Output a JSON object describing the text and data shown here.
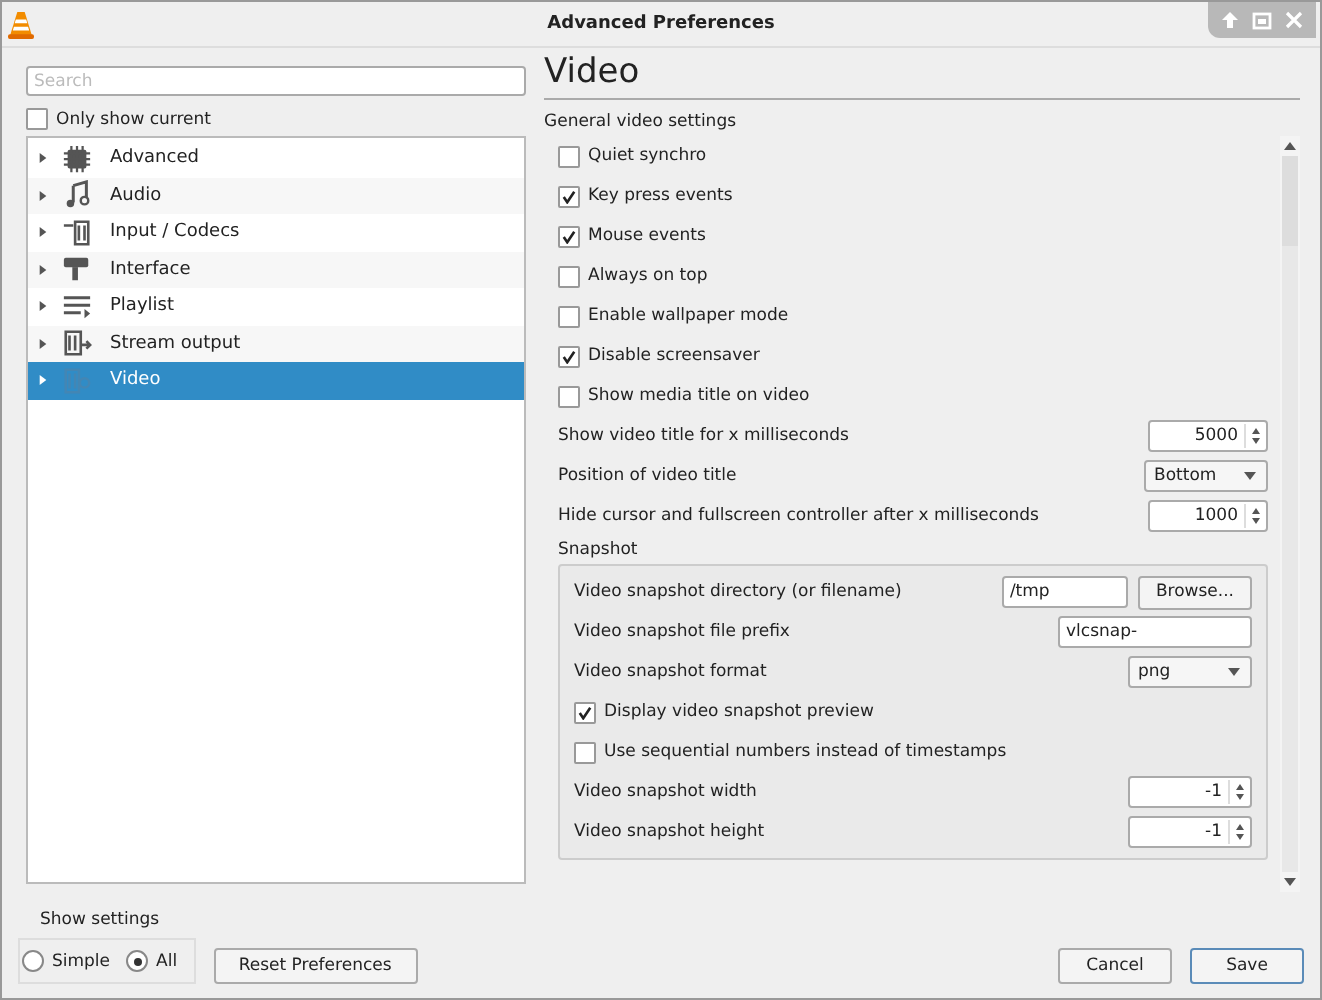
{
  "window": {
    "title": "Advanced Preferences"
  },
  "sidebar": {
    "search": {
      "placeholder": "Search"
    },
    "only_show_current": {
      "label": "Only show current",
      "checked": false
    },
    "tree": [
      {
        "label": "Advanced",
        "selected": false,
        "expanded": false
      },
      {
        "label": "Audio",
        "selected": false,
        "expanded": false
      },
      {
        "label": "Input / Codecs",
        "selected": false,
        "expanded": false
      },
      {
        "label": "Interface",
        "selected": false,
        "expanded": false
      },
      {
        "label": "Playlist",
        "selected": false,
        "expanded": false
      },
      {
        "label": "Stream output",
        "selected": false,
        "expanded": false
      },
      {
        "label": "Video",
        "selected": true,
        "expanded": false
      }
    ]
  },
  "panel": {
    "title": "Video",
    "section": "General video settings",
    "settings": [
      {
        "kind": "checkbox",
        "label": "Quiet synchro",
        "checked": false
      },
      {
        "kind": "checkbox",
        "label": "Key press events",
        "checked": true
      },
      {
        "kind": "checkbox",
        "label": "Mouse events",
        "checked": true
      },
      {
        "kind": "checkbox",
        "label": "Always on top",
        "checked": false
      },
      {
        "kind": "checkbox",
        "label": "Enable wallpaper mode",
        "checked": false
      },
      {
        "kind": "checkbox",
        "label": "Disable screensaver",
        "checked": true
      },
      {
        "kind": "checkbox",
        "label": "Show media title on video",
        "checked": false
      },
      {
        "kind": "spin",
        "label": "Show video title for x milliseconds",
        "value": "5000"
      },
      {
        "kind": "select",
        "label": "Position of video title",
        "value": "Bottom"
      },
      {
        "kind": "spin",
        "label": "Hide cursor and fullscreen controller after x milliseconds",
        "value": "1000"
      }
    ],
    "snapshot": {
      "title": "Snapshot",
      "settings": [
        {
          "kind": "path",
          "label": "Video snapshot directory (or filename)",
          "value": "/tmp",
          "button": "Browse..."
        },
        {
          "kind": "text",
          "label": "Video snapshot file prefix",
          "value": "vlcsnap-"
        },
        {
          "kind": "select",
          "label": "Video snapshot format",
          "value": "png"
        },
        {
          "kind": "checkbox",
          "label": "Display video snapshot preview",
          "checked": true
        },
        {
          "kind": "checkbox",
          "label": "Use sequential numbers instead of timestamps",
          "checked": false
        },
        {
          "kind": "spin",
          "label": "Video snapshot width",
          "value": "-1"
        },
        {
          "kind": "spin",
          "label": "Video snapshot height",
          "value": "-1"
        }
      ]
    }
  },
  "footer": {
    "show_settings": {
      "label": "Show settings",
      "options": [
        {
          "label": "Simple",
          "selected": false
        },
        {
          "label": "All",
          "selected": true
        }
      ]
    },
    "reset_button": "Reset Preferences",
    "buttons": [
      {
        "label": "Cancel",
        "default": false
      },
      {
        "label": "Save",
        "default": true
      }
    ]
  }
}
